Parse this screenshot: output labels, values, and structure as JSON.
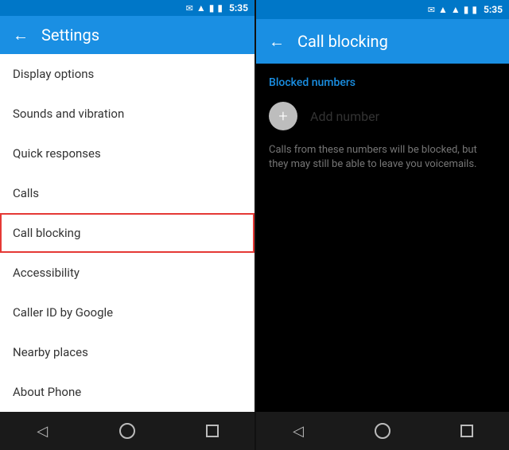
{
  "left": {
    "statusBar": {
      "time": "5:35",
      "icons": [
        "mail",
        "wifi",
        "signal",
        "battery"
      ]
    },
    "toolbar": {
      "back_icon": "←",
      "title": "Settings"
    },
    "menuItems": [
      {
        "id": "display-options",
        "label": "Display options",
        "active": false
      },
      {
        "id": "sounds-vibration",
        "label": "Sounds and vibration",
        "active": false
      },
      {
        "id": "quick-responses",
        "label": "Quick responses",
        "active": false
      },
      {
        "id": "calls",
        "label": "Calls",
        "active": false
      },
      {
        "id": "call-blocking",
        "label": "Call blocking",
        "active": true
      },
      {
        "id": "accessibility",
        "label": "Accessibility",
        "active": false
      },
      {
        "id": "caller-id",
        "label": "Caller ID by Google",
        "active": false
      },
      {
        "id": "nearby-places",
        "label": "Nearby places",
        "active": false
      },
      {
        "id": "about-phone",
        "label": "About Phone",
        "active": false
      }
    ],
    "bottomNav": {
      "back": "◁",
      "home": "",
      "recent": ""
    }
  },
  "right": {
    "statusBar": {
      "time": "5:35"
    },
    "toolbar": {
      "back_icon": "←",
      "title": "Call blocking"
    },
    "content": {
      "blocked_numbers_label": "Blocked numbers",
      "add_number_label": "Add number",
      "add_icon": "+",
      "description": "Calls from these numbers will be blocked, but they may still be able to leave you voicemails."
    },
    "bottomNav": {
      "back": "◁",
      "home": "",
      "recent": ""
    }
  }
}
